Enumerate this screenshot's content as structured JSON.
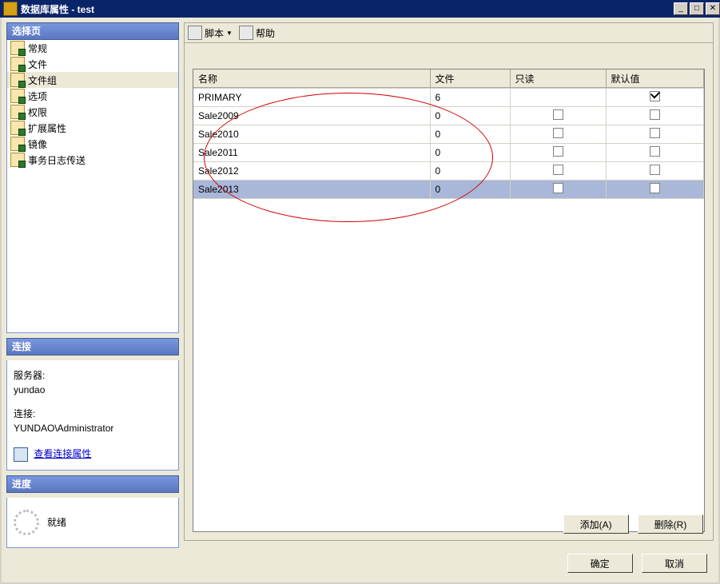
{
  "window": {
    "title": "数据库属性 - test"
  },
  "leftpanel": {
    "select_header": "选择页",
    "nav": [
      {
        "label": "常规"
      },
      {
        "label": "文件"
      },
      {
        "label": "文件组",
        "selected": true
      },
      {
        "label": "选项"
      },
      {
        "label": "权限"
      },
      {
        "label": "扩展属性"
      },
      {
        "label": "镜像"
      },
      {
        "label": "事务日志传送"
      }
    ],
    "conn_header": "连接",
    "server_label": "服务器:",
    "server_value": "yundao",
    "conn_label": "连接:",
    "conn_value": "YUNDAO\\Administrator",
    "view_conn_link": "查看连接属性",
    "progress_header": "进度",
    "progress_status": "就绪"
  },
  "toolbar": {
    "script": "脚本",
    "help": "帮助"
  },
  "grid": {
    "columns": {
      "name": "名称",
      "file": "文件",
      "readonly": "只读",
      "default": "默认值"
    },
    "rows": [
      {
        "name": "PRIMARY",
        "file": "6",
        "readonly": null,
        "default": true,
        "selected": false
      },
      {
        "name": "Sale2009",
        "file": "0",
        "readonly": false,
        "default": false,
        "selected": false
      },
      {
        "name": "Sale2010",
        "file": "0",
        "readonly": false,
        "default": false,
        "selected": false
      },
      {
        "name": "Sale2011",
        "file": "0",
        "readonly": false,
        "default": false,
        "selected": false
      },
      {
        "name": "Sale2012",
        "file": "0",
        "readonly": false,
        "default": false,
        "selected": false
      },
      {
        "name": "Sale2013",
        "file": "0",
        "readonly": false,
        "default": false,
        "selected": true
      }
    ]
  },
  "buttons": {
    "add": "添加(A)",
    "delete": "删除(R)",
    "ok": "确定",
    "cancel": "取消"
  }
}
